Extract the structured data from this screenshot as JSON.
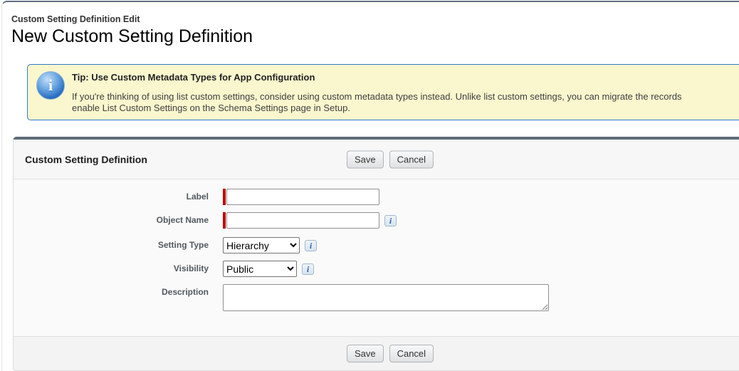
{
  "header": {
    "breadcrumb": "Custom Setting Definition Edit",
    "title": "New Custom Setting Definition"
  },
  "tip_box": {
    "title": "Tip: Use Custom Metadata Types for App Configuration",
    "body_line1": "If you're thinking of using list custom settings, consider using custom metadata types instead. Unlike list custom settings, you can migrate the records",
    "body_line2": "enable List Custom Settings on the Schema Settings page in Setup.",
    "info_icon_glyph": "i"
  },
  "form": {
    "section_title": "Custom Setting Definition",
    "save_label": "Save",
    "cancel_label": "Cancel",
    "info_icon_glyph": "i",
    "fields": {
      "label": {
        "label": "Label",
        "value": "",
        "required": true
      },
      "object_name": {
        "label": "Object Name",
        "value": "",
        "required": true,
        "has_info": true
      },
      "setting_type": {
        "label": "Setting Type",
        "value": "Hierarchy",
        "has_info": true
      },
      "visibility": {
        "label": "Visibility",
        "value": "Public",
        "has_info": true
      },
      "description": {
        "label": "Description",
        "value": ""
      }
    }
  },
  "colors": {
    "panel_accent_bar": "#5d6c7a",
    "tip_background": "#faf7ce",
    "tip_border": "#3079c6",
    "tip_icon_blue": "#2a6fc0",
    "required_marker_red": "#c00000",
    "info_icon_blue": "#2a66a8"
  }
}
